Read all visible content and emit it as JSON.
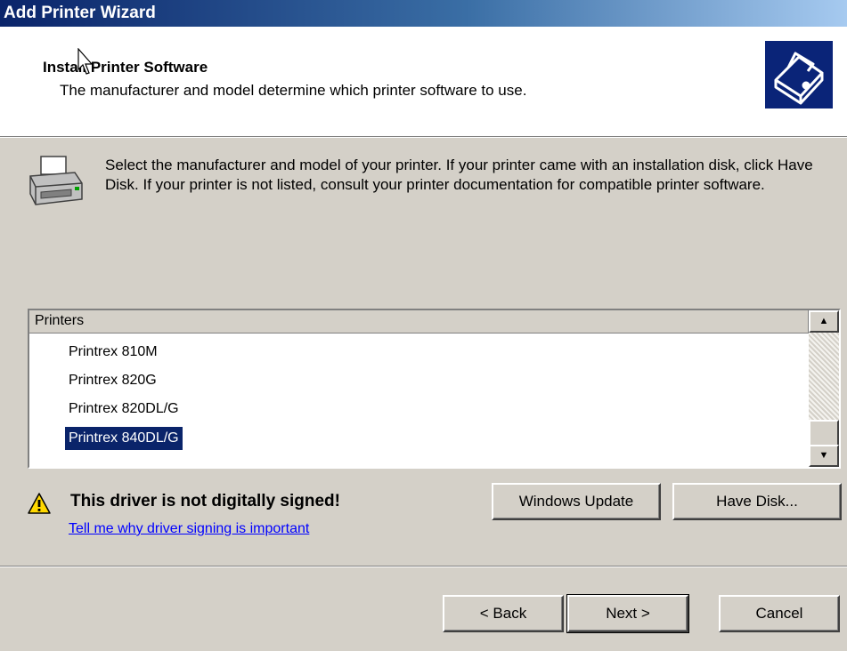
{
  "window": {
    "title": "Add Printer Wizard"
  },
  "header": {
    "title": "Install Printer Software",
    "subtitle": "The manufacturer and model determine which printer software to use.",
    "icon": "printer-wizard-icon"
  },
  "intro": {
    "icon": "printer-icon",
    "text": "Select the manufacturer and model of your printer. If your printer came with an installation disk, click Have Disk. If your printer is not listed, consult your printer documentation for compatible printer software."
  },
  "printers_list": {
    "header": "Printers",
    "items": [
      {
        "label": "Printrex 810M",
        "selected": false
      },
      {
        "label": "Printrex 820G",
        "selected": false
      },
      {
        "label": "Printrex 820DL/G",
        "selected": false
      },
      {
        "label": "Printrex 840DL/G",
        "selected": true
      }
    ]
  },
  "warning": {
    "icon": "warning-icon",
    "text": "This driver is not digitally signed!",
    "link": "Tell me why driver signing is important"
  },
  "buttons": {
    "windows_update": "Windows Update",
    "have_disk": "Have Disk...",
    "back": "< Back",
    "next": "Next >",
    "cancel": "Cancel"
  },
  "colors": {
    "title_bar": "#0a246a",
    "dialog_bg": "#d4d0c8",
    "selection": "#0a246a",
    "link": "#0000ff"
  }
}
